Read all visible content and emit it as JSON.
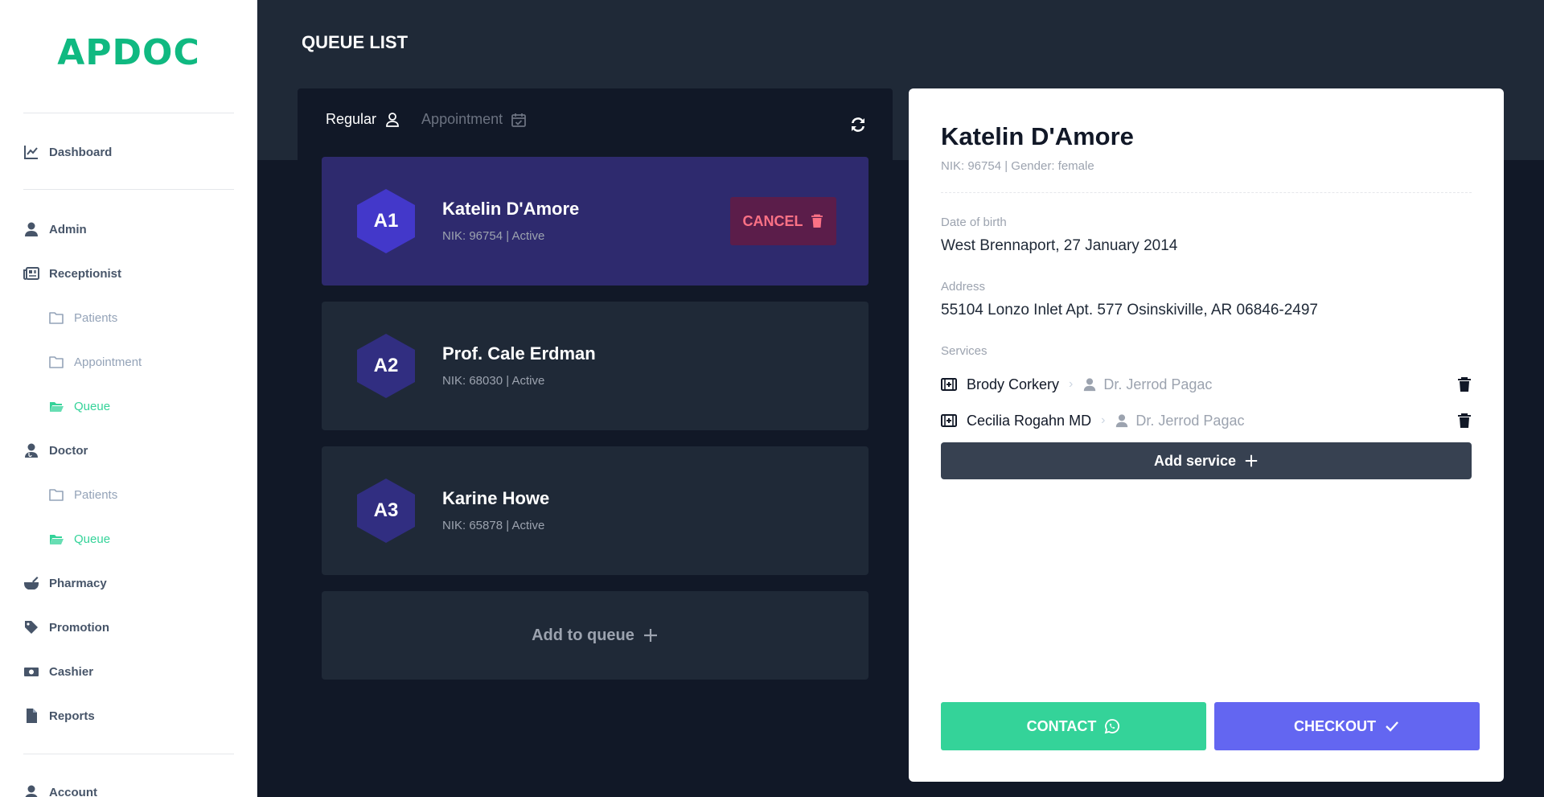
{
  "app": {
    "logo": "APDOC",
    "accent": "#10b981"
  },
  "sidebar": {
    "items": [
      {
        "label": "Dashboard",
        "icon": "chart-line-icon"
      },
      {
        "label": "Admin",
        "icon": "user-icon"
      },
      {
        "label": "Receptionist",
        "icon": "newspaper-icon"
      },
      {
        "label": "Patients",
        "icon": "folder-icon"
      },
      {
        "label": "Appointment",
        "icon": "folder-icon"
      },
      {
        "label": "Queue",
        "icon": "folder-open-icon",
        "active": true
      },
      {
        "label": "Doctor",
        "icon": "user-doctor-icon"
      },
      {
        "label": "Patients",
        "icon": "folder-icon"
      },
      {
        "label": "Queue",
        "icon": "folder-open-icon",
        "active": true
      },
      {
        "label": "Pharmacy",
        "icon": "mortar-pestle-icon"
      },
      {
        "label": "Promotion",
        "icon": "tag-icon"
      },
      {
        "label": "Cashier",
        "icon": "money-bill-icon"
      },
      {
        "label": "Reports",
        "icon": "file-icon"
      },
      {
        "label": "Account",
        "icon": "user-icon"
      }
    ]
  },
  "header": {
    "title": "QUEUE LIST"
  },
  "tabs": [
    {
      "label": "Regular",
      "icon": "user-outline-icon",
      "active": true
    },
    {
      "label": "Appointment",
      "icon": "calendar-check-icon",
      "active": false
    }
  ],
  "queue": {
    "items": [
      {
        "code": "A1",
        "name": "Katelin D'Amore",
        "meta": "NIK: 96754 | Active",
        "selected": true
      },
      {
        "code": "A2",
        "name": "Prof. Cale Erdman",
        "meta": "NIK: 68030 | Active",
        "selected": false
      },
      {
        "code": "A3",
        "name": "Karine Howe",
        "meta": "NIK: 65878 | Active",
        "selected": false
      }
    ],
    "cancel_label": "CANCEL",
    "add_label": "Add to queue"
  },
  "detail": {
    "name": "Katelin D'Amore",
    "sub": "NIK: 96754 | Gender: female",
    "dob_label": "Date of birth",
    "dob_value": "West Brennaport, 27 January 2014",
    "address_label": "Address",
    "address_value": "55104 Lonzo Inlet Apt. 577 Osinskiville, AR 06846-2497",
    "services_label": "Services",
    "services": [
      {
        "service": "Brody Corkery",
        "doctor": "Dr. Jerrod Pagac"
      },
      {
        "service": "Cecilia Rogahn MD",
        "doctor": "Dr. Jerrod Pagac"
      }
    ],
    "add_service_label": "Add service",
    "contact_label": "CONTACT",
    "checkout_label": "CHECKOUT"
  }
}
